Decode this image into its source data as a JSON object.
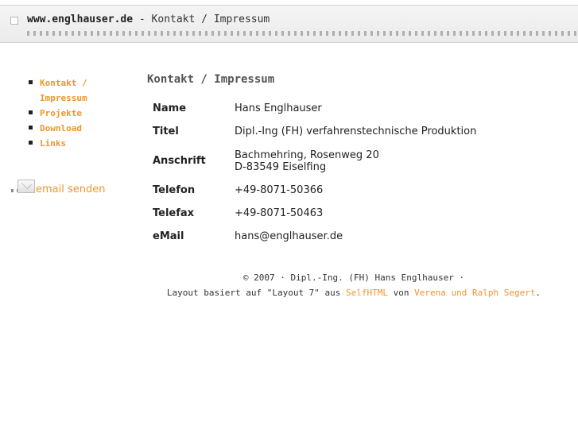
{
  "header": {
    "site": "www.englhauser.de",
    "separator": " - ",
    "page": "Kontakt / Impressum"
  },
  "nav": {
    "items": [
      {
        "label": "Kontakt / Impressum"
      },
      {
        "label": "Projekte"
      },
      {
        "label": "Download"
      },
      {
        "label": "Links"
      }
    ]
  },
  "mail_link": {
    "label": "email senden",
    "icon": "mail-envelope-icon"
  },
  "main": {
    "title": "Kontakt / Impressum",
    "rows": [
      {
        "key": "Name",
        "value": "Hans Englhauser"
      },
      {
        "key": "Titel",
        "value": "Dipl.-Ing (FH) verfahrenstechnische Produktion"
      },
      {
        "key": "Anschrift",
        "value_line1": "Bachmehring, Rosenweg 20",
        "value_line2": "D-83549 Eiselfing"
      },
      {
        "key": "Telefon",
        "value": "+49-8071-50366"
      },
      {
        "key": "Telefax",
        "value": "+49-8071-50463"
      },
      {
        "key": "eMail",
        "value": "hans@englhauser.de"
      }
    ]
  },
  "footer": {
    "line1": "© 2007 · Dipl.-Ing. (FH) Hans Englhauser ·",
    "line2_a": "Layout basiert auf \"Layout 7\" aus ",
    "line2_link1": "SelfHTML",
    "line2_b": " von ",
    "line2_link2": "Verena und Ralph Segert",
    "line2_c": "."
  },
  "colors": {
    "accent": "#f0962a",
    "text": "#222222",
    "title": "#555555"
  }
}
